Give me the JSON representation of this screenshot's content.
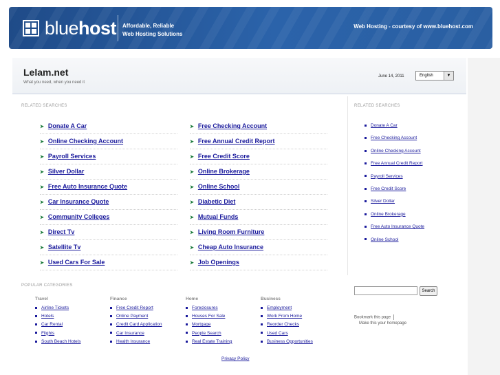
{
  "banner": {
    "logo_text_light": "blue",
    "logo_text_bold": "host",
    "tagline_line1": "Affordable, Reliable",
    "tagline_line2": "Web Hosting Solutions",
    "courtesy": "Web Hosting - courtesy of www.bluehost.com"
  },
  "site": {
    "title": "Lelam.net",
    "subtitle": "What you need, when you need it",
    "date": "June 14, 2011",
    "language": "English"
  },
  "related_left": {
    "label": "RELATED SEARCHES",
    "col1": [
      "Donate A Car",
      "Online Checking Account",
      "Payroll Services",
      "Silver Dollar",
      "Free Auto Insurance Quote",
      "Car Insurance Quote",
      "Community Colleges",
      "Direct Tv",
      "Satellite Tv",
      "Used Cars For Sale"
    ],
    "col2": [
      "Free Checking Account",
      "Free Annual Credit Report",
      "Free Credit Score",
      "Online Brokerage",
      "Online School",
      "Diabetic Diet",
      "Mutual Funds",
      "Living Room Furniture",
      "Cheap Auto Insurance",
      "Job Openings"
    ]
  },
  "related_right": {
    "label": "RELATED SEARCHES",
    "items": [
      "Donate A Car",
      "Free Checking Account",
      "Online Checking Account",
      "Free Annual Credit Report",
      "Payroll Services",
      "Free Credit Score",
      "Silver Dollar",
      "Online Brokerage",
      "Free Auto Insurance Quote",
      "Online School"
    ]
  },
  "popular": {
    "label": "POPULAR CATEGORIES",
    "categories": [
      {
        "name": "Travel",
        "items": [
          "Airline Tickets",
          "Hotels",
          "Car Rental",
          "Flights",
          "South Beach Hotels"
        ]
      },
      {
        "name": "Finance",
        "items": [
          "Free Credit Report",
          "Online Payment",
          "Credit Card Application",
          "Car Insurance",
          "Health Insurance"
        ]
      },
      {
        "name": "Home",
        "items": [
          "Foreclosures",
          "Houses For Sale",
          "Mortgage",
          "People Search",
          "Real Estate Training"
        ]
      },
      {
        "name": "Business",
        "items": [
          "Employment",
          "Work From Home",
          "Reorder Checks",
          "Used Cars",
          "Business Opportunities"
        ]
      }
    ]
  },
  "search": {
    "button": "Search"
  },
  "bookmark": {
    "text": "Bookmark this page",
    "homepage": "Make this your homepage"
  },
  "footer": {
    "privacy": "Privacy Policy"
  },
  "colors": {
    "banner": "#2b63aa",
    "link": "#1a1a9c",
    "arrow": "#1a7a3a"
  }
}
